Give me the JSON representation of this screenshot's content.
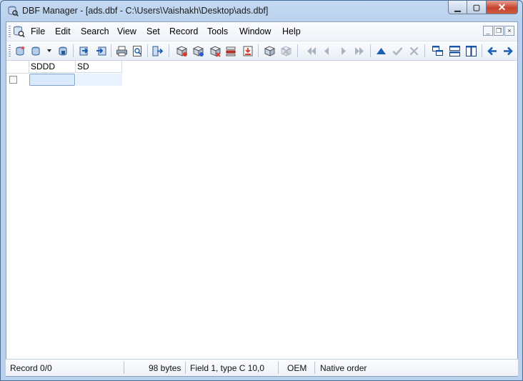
{
  "window": {
    "title": "DBF Manager - [ads.dbf - C:\\Users\\Vaishakh\\Desktop\\ads.dbf]",
    "controls": {
      "minimize": "▁",
      "maximize": "▢",
      "close": "✕"
    }
  },
  "menu": {
    "items": [
      "File",
      "Edit",
      "Search",
      "View",
      "Set",
      "Record",
      "Tools",
      "Window",
      "Help"
    ],
    "mdi_controls": {
      "minimize": "_",
      "restore": "❐",
      "close": "×"
    }
  },
  "grid": {
    "columns": [
      "SDDD",
      "SD"
    ],
    "rows": [
      [
        "",
        ""
      ]
    ]
  },
  "status": {
    "record": "Record 0/0",
    "size": "98 bytes",
    "field": "Field 1, type C 10,0",
    "codepage": "OEM",
    "order": "Native order"
  },
  "colors": {
    "accent": "#1b5fb5",
    "selection": "#dbeafb",
    "disabled": "#a9b4c2"
  }
}
